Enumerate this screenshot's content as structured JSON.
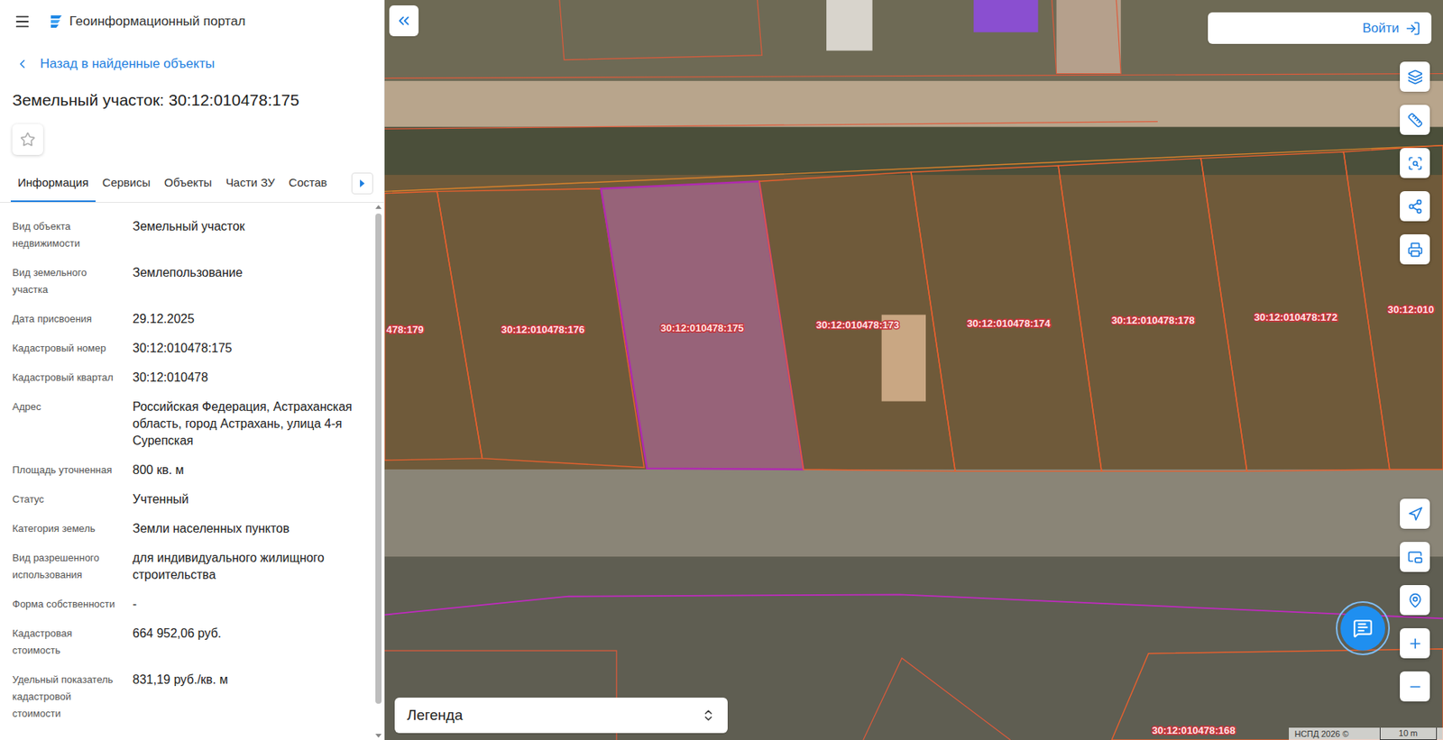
{
  "header": {
    "title": "Геоинформационный портал"
  },
  "back_link": "Назад в найденные объекты",
  "object_title": "Земельный участок: 30:12:010478:175",
  "favorite": false,
  "tabs": [
    {
      "label": "Информация",
      "selected": true
    },
    {
      "label": "Сервисы",
      "selected": false
    },
    {
      "label": "Объекты",
      "selected": false
    },
    {
      "label": "Части ЗУ",
      "selected": false
    },
    {
      "label": "Состав",
      "selected": false
    }
  ],
  "fields": [
    {
      "label": "Вид объекта недвижимости",
      "value": "Земельный участок"
    },
    {
      "label": "Вид земельного участка",
      "value": "Землепользование"
    },
    {
      "label": "Дата присвоения",
      "value": "29.12.2025"
    },
    {
      "label": "Кадастровый номер",
      "value": "30:12:010478:175"
    },
    {
      "label": "Кадастровый квартал",
      "value": "30:12:010478"
    },
    {
      "label": "Адрес",
      "value": "Российская Федерация, Астраханская область, город Астрахань, улица 4-я Сурепская"
    },
    {
      "label": "Площадь уточненная",
      "value": "800 кв. м"
    },
    {
      "label": "Статус",
      "value": "Учтенный"
    },
    {
      "label": "Категория земель",
      "value": "Земли населенных пунктов"
    },
    {
      "label": "Вид разрешенного использования",
      "value": "для индивидуального жилищного строительства"
    },
    {
      "label": "Форма собственности",
      "value": "-"
    },
    {
      "label": "Кадастровая стоимость",
      "value": "664 952,06 руб."
    },
    {
      "label": "Удельный показатель кадастровой стоимости",
      "value": "831,19 руб./кв. м"
    }
  ],
  "scrollbar": {
    "level": 0.95
  },
  "map": {
    "login_button": "Войти",
    "legend": "Легенда",
    "attribution": "НСПД 2026 ©",
    "scale": "10 m",
    "parcels": [
      {
        "label": "478:179",
        "selected": false
      },
      {
        "label": "30:12:010478:176",
        "selected": false
      },
      {
        "label": "30:12:010478:175",
        "selected": true
      },
      {
        "label": "30:12:010478:173",
        "selected": false
      },
      {
        "label": "30:12:010478:174",
        "selected": false
      },
      {
        "label": "30:12:010478:178",
        "selected": false
      },
      {
        "label": "30:12:010478:172",
        "selected": false
      },
      {
        "label": "30:12:010",
        "selected": false
      },
      {
        "label": "30:12:010478:168",
        "selected": false
      }
    ]
  }
}
